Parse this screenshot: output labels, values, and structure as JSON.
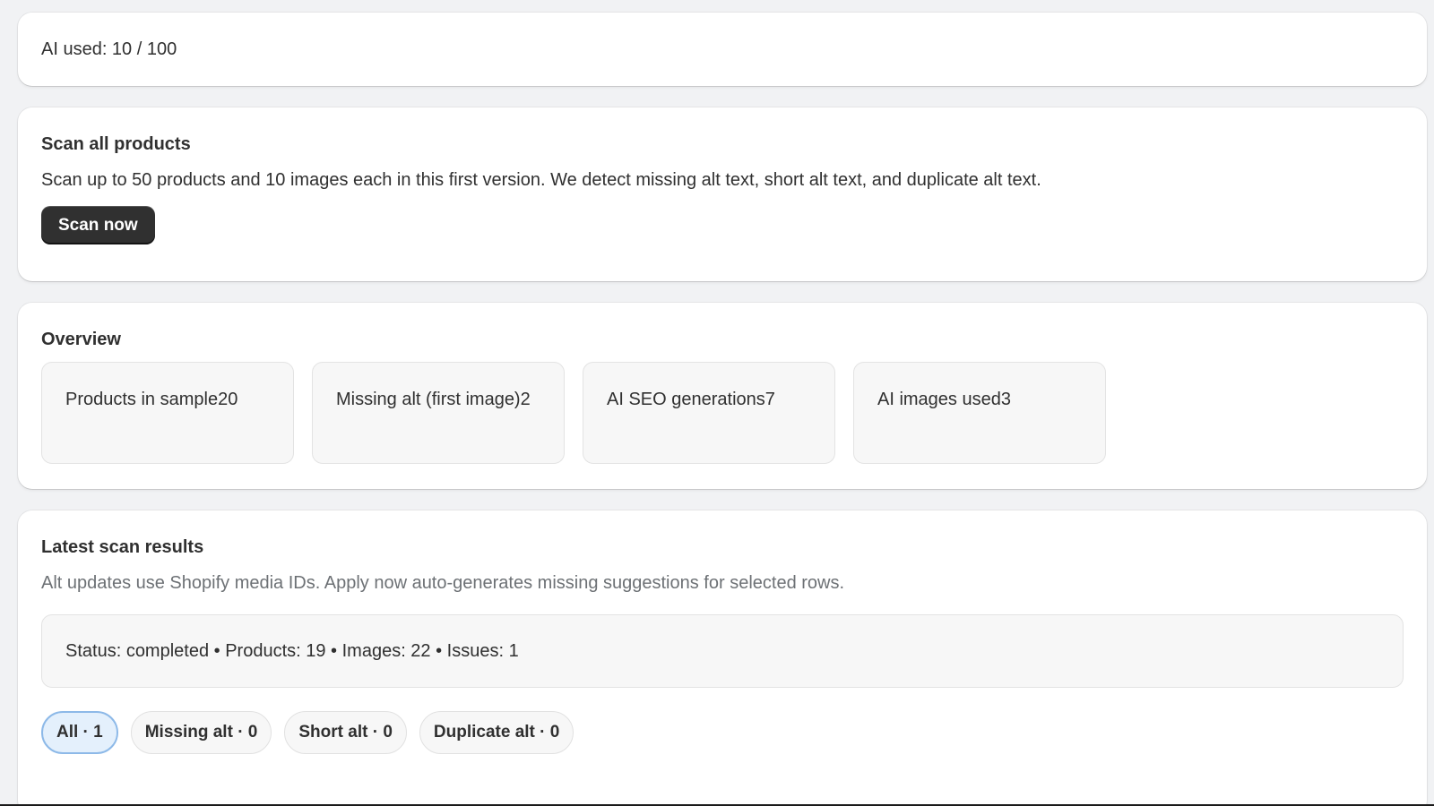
{
  "usage": {
    "text": "AI used: 10 / 100"
  },
  "scan": {
    "title": "Scan all products",
    "description": "Scan up to 50 products and 10 images each in this first version. We detect missing alt text, short alt text, and duplicate alt text.",
    "button_label": "Scan now"
  },
  "overview": {
    "title": "Overview",
    "stats": [
      {
        "text": "Products in sample20"
      },
      {
        "text": "Missing alt (first image)2"
      },
      {
        "text": "AI SEO generations7"
      },
      {
        "text": "AI images used3"
      }
    ]
  },
  "results": {
    "title": "Latest scan results",
    "description": "Alt updates use Shopify media IDs. Apply now auto-generates missing suggestions for selected rows.",
    "status": "Status: completed • Products: 19 • Images: 22 • Issues: 1",
    "filters": [
      {
        "label": "All · 1",
        "active": true
      },
      {
        "label": "Missing alt · 0",
        "active": false
      },
      {
        "label": "Short alt · 0",
        "active": false
      },
      {
        "label": "Duplicate alt · 0",
        "active": false
      }
    ]
  },
  "colors": {
    "primary_button": "#303030",
    "active_filter_bg": "#e4f0fc",
    "active_filter_border": "#8db9e8",
    "page_bg": "#f1f2f4"
  }
}
